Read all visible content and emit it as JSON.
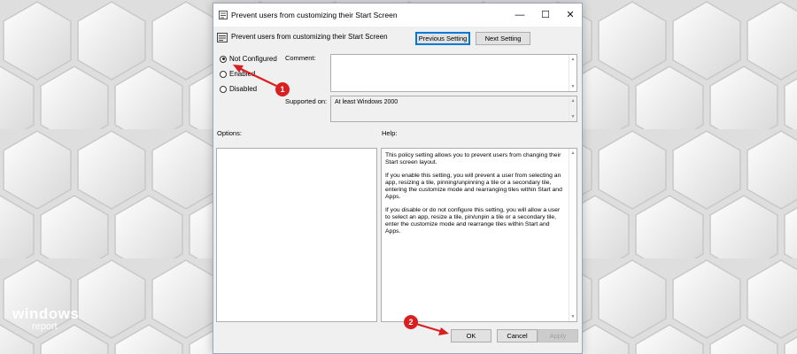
{
  "window": {
    "title": "Prevent users from customizing their Start Screen",
    "controls": {
      "minimize": "—",
      "maximize": "☐",
      "close": "✕"
    }
  },
  "header": {
    "title": "Prevent users from customizing their Start Screen",
    "previous_label": "Previous Setting",
    "next_label": "Next Setting"
  },
  "state": {
    "options": [
      {
        "label": "Not Configured",
        "selected": true
      },
      {
        "label": "Enabled",
        "selected": false
      },
      {
        "label": "Disabled",
        "selected": false
      }
    ]
  },
  "comment": {
    "label": "Comment:",
    "value": ""
  },
  "supported": {
    "label": "Supported on:",
    "value": "At least Windows 2000"
  },
  "options_panel": {
    "label": "Options:"
  },
  "help_panel": {
    "label": "Help:",
    "paragraphs": [
      "This policy setting allows you to prevent users from changing their Start screen layout.",
      "If you enable this setting, you will prevent a user from selecting an app, resizing a tile, pinning/unpinning a tile or a secondary tile, entering the customize mode and rearranging tiles within Start and Apps.",
      "If you disable or do not configure this setting, you will allow a user to select an app, resize a tile, pin/unpin a tile or a secondary tile, enter the customize mode and rearrange tiles within Start and Apps."
    ]
  },
  "footer": {
    "ok": "OK",
    "cancel": "Cancel",
    "apply": "Apply"
  },
  "annotations": [
    "1",
    "2"
  ],
  "brand": {
    "line1": "windows",
    "line2": "report"
  },
  "colors": {
    "marker": "#d92020",
    "focus": "#0078d7",
    "window_bg": "#f0f0f0"
  }
}
